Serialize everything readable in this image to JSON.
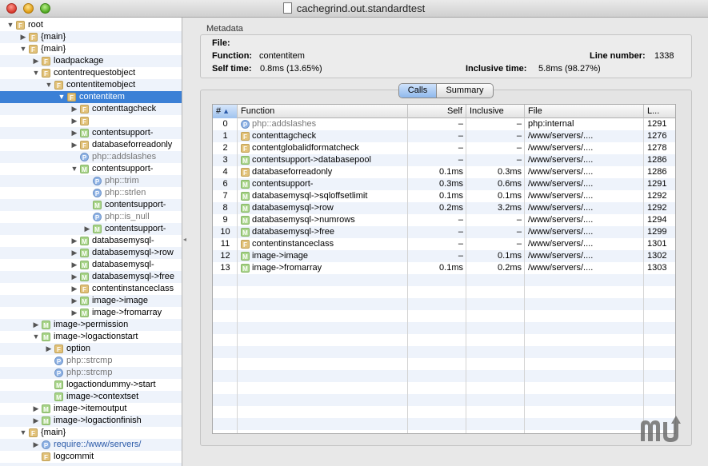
{
  "window": {
    "title": "cachegrind.out.standardtest"
  },
  "tree": [
    {
      "label": "root",
      "badge": "F",
      "level": 0,
      "toggle": "open"
    },
    {
      "label": "{main}",
      "badge": "F",
      "level": 1,
      "toggle": "closed"
    },
    {
      "label": "{main}",
      "badge": "F",
      "level": 1,
      "toggle": "open"
    },
    {
      "label": "loadpackage",
      "badge": "F",
      "level": 2,
      "toggle": "closed"
    },
    {
      "label": "contentrequestobject",
      "badge": "F",
      "level": 2,
      "toggle": "open"
    },
    {
      "label": "contentitemobject",
      "badge": "F",
      "level": 3,
      "toggle": "open"
    },
    {
      "label": "contentitem",
      "badge": "F",
      "level": 4,
      "toggle": "open",
      "selected": true
    },
    {
      "label": "contenttagcheck",
      "badge": "F",
      "level": 5,
      "toggle": "closed"
    },
    {
      "label": "",
      "badge": "F",
      "level": 5,
      "toggle": "closed"
    },
    {
      "label": "contentsupport-",
      "badge": "M",
      "level": 5,
      "toggle": "closed"
    },
    {
      "label": "databaseforreadonly",
      "badge": "F",
      "level": 5,
      "toggle": "closed"
    },
    {
      "label": "php::addslashes",
      "badge": "P",
      "level": 5,
      "toggle": "none",
      "php": true
    },
    {
      "label": "contentsupport-",
      "badge": "M",
      "level": 5,
      "toggle": "open"
    },
    {
      "label": "php::trim",
      "badge": "P",
      "level": 6,
      "toggle": "none",
      "php": true
    },
    {
      "label": "php::strlen",
      "badge": "P",
      "level": 6,
      "toggle": "none",
      "php": true
    },
    {
      "label": "contentsupport-",
      "badge": "M",
      "level": 6,
      "toggle": "none"
    },
    {
      "label": "php::is_null",
      "badge": "P",
      "level": 6,
      "toggle": "none",
      "php": true
    },
    {
      "label": "contentsupport-",
      "badge": "M",
      "level": 6,
      "toggle": "closed"
    },
    {
      "label": "databasemysql-",
      "badge": "M",
      "level": 5,
      "toggle": "closed"
    },
    {
      "label": "databasemysql->row",
      "badge": "M",
      "level": 5,
      "toggle": "closed"
    },
    {
      "label": "databasemysql-",
      "badge": "M",
      "level": 5,
      "toggle": "closed"
    },
    {
      "label": "databasemysql->free",
      "badge": "M",
      "level": 5,
      "toggle": "closed"
    },
    {
      "label": "contentinstanceclass",
      "badge": "F",
      "level": 5,
      "toggle": "closed"
    },
    {
      "label": "image->image",
      "badge": "M",
      "level": 5,
      "toggle": "closed"
    },
    {
      "label": "image->fromarray",
      "badge": "M",
      "level": 5,
      "toggle": "closed"
    },
    {
      "label": "image->permission",
      "badge": "M",
      "level": 2,
      "toggle": "closed"
    },
    {
      "label": "image->logactionstart",
      "badge": "M",
      "level": 2,
      "toggle": "open"
    },
    {
      "label": "option",
      "badge": "F",
      "level": 3,
      "toggle": "closed"
    },
    {
      "label": "php::strcmp",
      "badge": "P",
      "level": 3,
      "toggle": "none",
      "php": true
    },
    {
      "label": "php::strcmp",
      "badge": "P",
      "level": 3,
      "toggle": "none",
      "php": true
    },
    {
      "label": "logactiondummy->start",
      "badge": "M",
      "level": 3,
      "toggle": "none"
    },
    {
      "label": "image->contextset",
      "badge": "M",
      "level": 3,
      "toggle": "none"
    },
    {
      "label": "image->itemoutput",
      "badge": "M",
      "level": 2,
      "toggle": "closed"
    },
    {
      "label": "image->logactionfinish",
      "badge": "M",
      "level": 2,
      "toggle": "closed"
    },
    {
      "label": "{main}",
      "badge": "F",
      "level": 1,
      "toggle": "open"
    },
    {
      "label": "require::/www/servers/",
      "badge": "P",
      "level": 2,
      "toggle": "closed",
      "require": true
    },
    {
      "label": "logcommit",
      "badge": "F",
      "level": 2,
      "toggle": "none"
    }
  ],
  "metadata": {
    "heading": "Metadata",
    "file_label": "File:",
    "file_value": "",
    "function_label": "Function:",
    "function_value": "contentitem",
    "line_label": "Line number:",
    "line_value": "1338",
    "self_label": "Self time:",
    "self_value": "0.8ms (13.65%)",
    "incl_label": "Inclusive time:",
    "incl_value": "5.8ms (98.27%)"
  },
  "segmented": {
    "calls": "Calls",
    "summary": "Summary"
  },
  "table": {
    "headers": {
      "idx": "#",
      "sort_arrow": "▲",
      "function": "Function",
      "self": "Self",
      "inclusive": "Inclusive",
      "file": "File",
      "line": "L..."
    },
    "rows": [
      {
        "idx": "0",
        "badge": "P",
        "fn": "php::addslashes",
        "self": "–",
        "incl": "–",
        "file": "php:internal",
        "line": "1291",
        "php": true
      },
      {
        "idx": "1",
        "badge": "F",
        "fn": "contenttagcheck",
        "self": "–",
        "incl": "–",
        "file": "/www/servers/....",
        "line": "1276"
      },
      {
        "idx": "2",
        "badge": "F",
        "fn": "contentglobalidformatcheck",
        "self": "–",
        "incl": "–",
        "file": "/www/servers/....",
        "line": "1278"
      },
      {
        "idx": "3",
        "badge": "M",
        "fn": "contentsupport->databasepool",
        "self": "–",
        "incl": "–",
        "file": "/www/servers/....",
        "line": "1286"
      },
      {
        "idx": "4",
        "badge": "F",
        "fn": "databaseforreadonly",
        "self": "0.1ms",
        "incl": "0.3ms",
        "file": "/www/servers/....",
        "line": "1286"
      },
      {
        "idx": "6",
        "badge": "M",
        "fn": "contentsupport-",
        "self": "0.3ms",
        "incl": "0.6ms",
        "file": "/www/servers/....",
        "line": "1291"
      },
      {
        "idx": "7",
        "badge": "M",
        "fn": "databasemysql->sqloffsetlimit",
        "self": "0.1ms",
        "incl": "0.1ms",
        "file": "/www/servers/....",
        "line": "1292"
      },
      {
        "idx": "8",
        "badge": "M",
        "fn": "databasemysql->row",
        "self": "0.2ms",
        "incl": "3.2ms",
        "file": "/www/servers/....",
        "line": "1292"
      },
      {
        "idx": "9",
        "badge": "M",
        "fn": "databasemysql->numrows",
        "self": "–",
        "incl": "–",
        "file": "/www/servers/....",
        "line": "1294"
      },
      {
        "idx": "10",
        "badge": "M",
        "fn": "databasemysql->free",
        "self": "–",
        "incl": "–",
        "file": "/www/servers/....",
        "line": "1299"
      },
      {
        "idx": "11",
        "badge": "F",
        "fn": "contentinstanceclass",
        "self": "–",
        "incl": "–",
        "file": "/www/servers/....",
        "line": "1301"
      },
      {
        "idx": "12",
        "badge": "M",
        "fn": "image->image",
        "self": "–",
        "incl": "0.1ms",
        "file": "/www/servers/....",
        "line": "1302"
      },
      {
        "idx": "13",
        "badge": "M",
        "fn": "image->fromarray",
        "self": "0.1ms",
        "incl": "0.2ms",
        "file": "/www/servers/....",
        "line": "1303"
      }
    ]
  },
  "colors": {
    "selection": "#3b80d6",
    "row_alt": "#eef3fb",
    "badge_function": "#e2c27a",
    "badge_method": "#a9d58a",
    "badge_php": "#8fb3e6"
  }
}
